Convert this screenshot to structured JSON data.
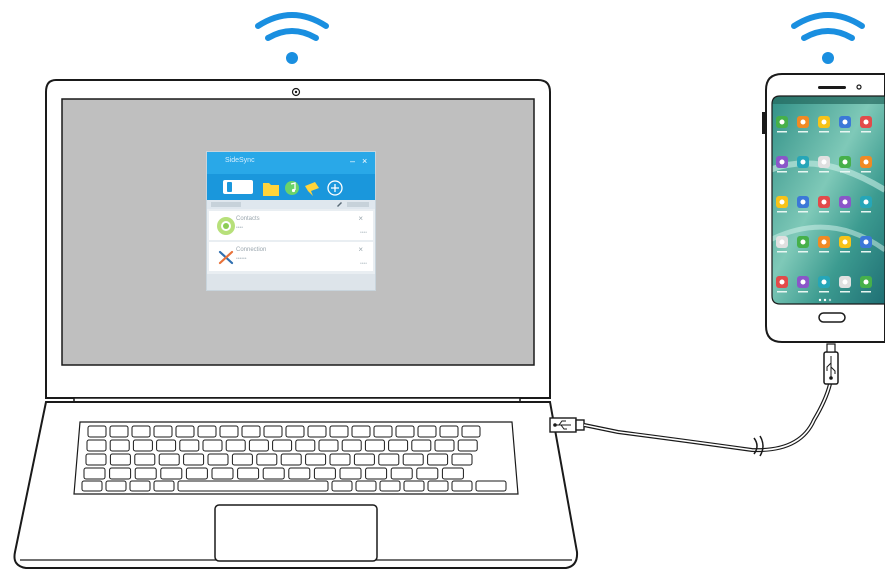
{
  "colors": {
    "wifi": "#1a8fe0",
    "outline": "#1a1a1a",
    "screen": "#bfbfbf",
    "app_titlebar": "#29a8e8",
    "app_toolbar": "#1a97dc",
    "cable": "#1a1a1a"
  },
  "icons": {
    "laptop_wifi": "wifi-icon",
    "phone_wifi": "wifi-icon",
    "laptop_usb": "usb-icon",
    "phone_usb": "usb-icon",
    "webcam": "webcam-icon"
  },
  "app_window": {
    "title": "SideSync",
    "minimize": "–",
    "close": "×",
    "toolbar_icons": [
      "phone-icon",
      "folder-icon",
      "music-icon",
      "pin-icon",
      "add-icon"
    ],
    "rows": [
      {
        "title": "Contacts",
        "subtitle": "••••",
        "close": "×",
        "meta": "••••",
        "icon": "contacts-app-icon"
      },
      {
        "title": "Connection",
        "subtitle": "••••••",
        "close": "×",
        "meta": "••••",
        "icon": "tools-icon"
      }
    ]
  },
  "phone": {
    "app_grid_icons": [
      [
        "phone-app-icon",
        "contacts-app-icon",
        "messages-app-icon",
        "internet-app-icon",
        "camera-app-icon"
      ],
      [
        "weather-app-icon",
        "gallery-app-icon",
        "memo-app-icon",
        "video-app-icon",
        "settings-app-icon"
      ],
      [
        "calendar-app-icon",
        "clock-app-icon",
        "game-app-icon",
        "samsung-app-icon",
        "tools-app-icon"
      ],
      [
        "s-health-app-icon",
        "music-app-icon",
        "email-app-icon",
        "galaxy-app-icon",
        "notes-app-icon"
      ],
      [
        "chrome-app-icon",
        "maps-app-icon",
        "youtube-app-icon",
        "store-app-icon",
        "android-app-icon"
      ]
    ]
  }
}
